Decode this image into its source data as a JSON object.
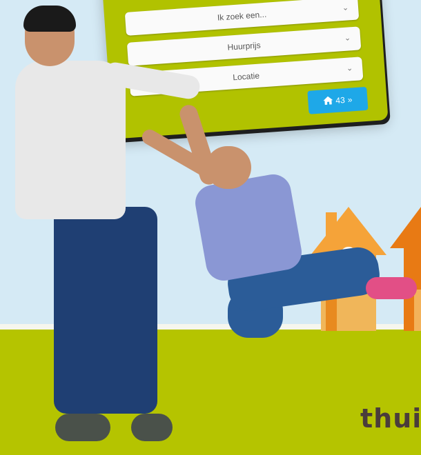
{
  "search": {
    "select_type": {
      "label": "Ik zoek een..."
    },
    "select_price": {
      "label": "Huurprijs"
    },
    "select_location": {
      "label": "Locatie"
    },
    "results_button": {
      "count": "43",
      "arrow": "»"
    }
  },
  "brand": {
    "text": "thuis"
  },
  "colors": {
    "card_green": "#b1c200",
    "ground_green": "#b5c400",
    "button_blue": "#1ea8e8",
    "sky": "#d5eaf5",
    "house_orange": "#f5a339"
  },
  "icons": {
    "results_button_icon": "home-icon",
    "select_chevron": "chevron-down-icon"
  }
}
